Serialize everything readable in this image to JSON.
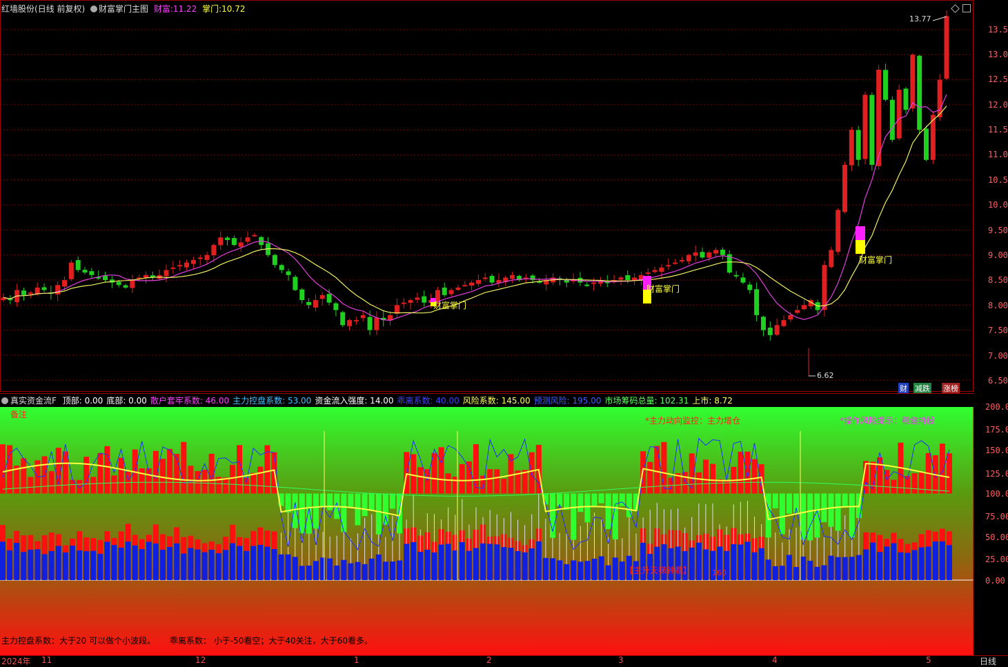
{
  "header": {
    "stock": "红墙股份",
    "period": "(日线 前复权)",
    "indicator": "财富掌门主图",
    "caifu_label": "财富:",
    "caifu_value": "11.22",
    "zhangmen_label": "掌门:",
    "zhangmen_value": "10.72"
  },
  "main_axis": [
    "13.50",
    "13.00",
    "12.50",
    "12.00",
    "11.50",
    "11.00",
    "10.50",
    "10.00",
    "9.50",
    "9.00",
    "8.50",
    "8.00",
    "7.50",
    "7.00",
    "6.50"
  ],
  "annotations": {
    "high": "13.77",
    "low": "6.62",
    "signal": "财富掌门"
  },
  "badges": [
    "财",
    "减跌",
    "涨榜"
  ],
  "sub_header": {
    "name": "真实资金流F",
    "items": [
      {
        "text": "顶部: 0.00",
        "color": "#ffffff"
      },
      {
        "text": "底部: 0.00",
        "color": "#ffffff"
      },
      {
        "text": "散户套牢系数: 46.00",
        "color": "#ff40ff"
      },
      {
        "text": "主力控盘系数: 53.00",
        "color": "#40c0ff"
      },
      {
        "text": "资金流入强度: 14.00",
        "color": "#ffffff"
      },
      {
        "text": "乖离系数: 40.00",
        "color": "#4040ff"
      },
      {
        "text": "风险系数: 145.00",
        "color": "#ffff60"
      },
      {
        "text": "预测风险: 195.00",
        "color": "#4060ff"
      },
      {
        "text": "市场筹码总量: 102.31",
        "color": "#60ff60"
      },
      {
        "text": "上市: 8.72",
        "color": "#ffff60"
      }
    ]
  },
  "sub_axis": [
    "200.0",
    "175.00",
    "150.00",
    "125.00",
    "100.00",
    "75.00",
    "50.00",
    "25.00",
    "0.00"
  ],
  "sub_text": {
    "note": "备注",
    "monitor": "*主力动向监控：主力增仓",
    "risk": "*操作风险提示：稳健持股",
    "bottom_tag": "【主升天梯钟鼎】",
    "num": "160",
    "footer1": "主力控盘系数：大于20 可以做个小波段。",
    "footer2": "乖离系数： 小于-50看空；大于40关注，大于60看多。"
  },
  "x_axis": [
    "2024年",
    "11",
    "12",
    "1",
    "2",
    "3",
    "4",
    "5"
  ],
  "period_tab": "日线"
}
